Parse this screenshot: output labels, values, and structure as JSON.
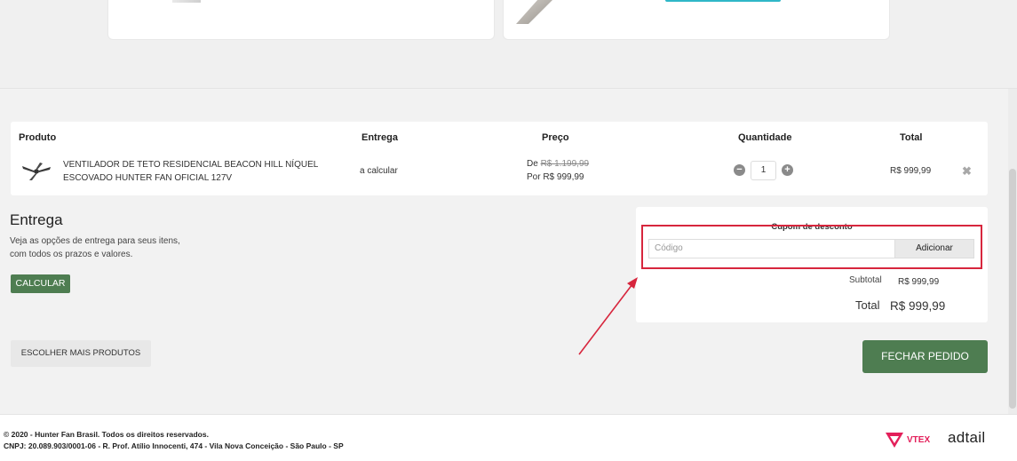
{
  "table": {
    "headers": {
      "product": "Produto",
      "delivery": "Entrega",
      "price": "Preço",
      "quantity": "Quantidade",
      "total": "Total"
    },
    "item": {
      "name_line1": "VENTILADOR DE TETO RESIDENCIAL BEACON HILL NÍQUEL",
      "name_line2": "ESCOVADO HUNTER FAN OFICIAL 127V",
      "delivery": "a calcular",
      "old_price_prefix": "De",
      "old_price": "R$ 1.199,99",
      "price": "Por R$ 999,99",
      "quantity": "1",
      "total": "R$ 999,99",
      "minus_symbol": "−",
      "plus_symbol": "+",
      "remove_symbol": "✖"
    }
  },
  "delivery": {
    "title": "Entrega",
    "desc_line1": "Veja as opções de entrega para seus itens,",
    "desc_line2": "com todos os prazos e valores.",
    "calc_button": "CALCULAR"
  },
  "more_products_button": "ESCOLHER MAIS PRODUTOS",
  "summary": {
    "coupon_title": "Cupom de desconto",
    "coupon_placeholder": "Código",
    "coupon_button": "Adicionar",
    "subtotal_label": "Subtotal",
    "subtotal_value": "R$ 999,99",
    "total_label": "Total",
    "total_value": "R$ 999,99"
  },
  "checkout_button": "FECHAR PEDIDO",
  "footer": {
    "line1": "© 2020 - Hunter Fan Brasil. Todos os direitos reservados.",
    "line2": "CNPJ: 20.089.903/0001-06 - R. Prof. Atílio Innocenti, 474 - Vila Nova Conceição - São Paulo - SP",
    "vtex_logo": "VTEX",
    "adtail_logo": "adtail"
  },
  "colors": {
    "accent_green": "#4e7d51",
    "highlight_red": "#d7263d",
    "teal": "#2fb7c7"
  },
  "icons": [
    "minus-circle-icon",
    "plus-circle-icon",
    "remove-x-icon",
    "ceiling-fan-icon",
    "red-arrow-annotation"
  ]
}
